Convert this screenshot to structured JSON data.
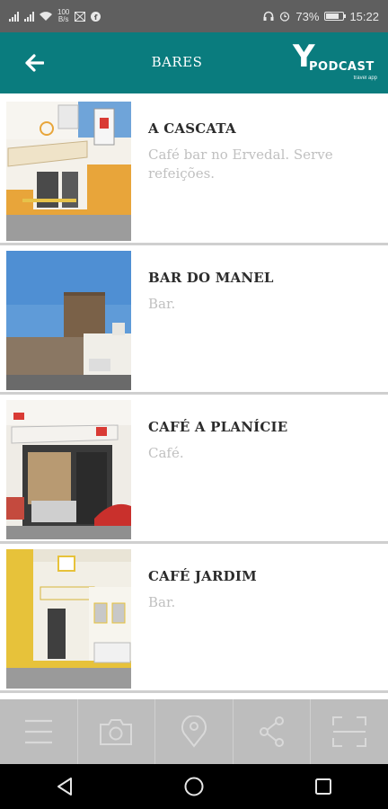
{
  "status_bar": {
    "network_speed": "100",
    "network_unit": "B/s",
    "battery": "73%",
    "battery_level": 0.73,
    "time": "15:22"
  },
  "app_bar": {
    "title": "BARES",
    "logo_mark": "Y",
    "logo_word": "PODCAST",
    "logo_sub": "travel app",
    "color": "#0a7c7e"
  },
  "items": [
    {
      "title": "A CASCATA",
      "description": "Café bar no Ervedal. Serve refeições."
    },
    {
      "title": "BAR DO MANEL",
      "description": "Bar."
    },
    {
      "title": "CAFÉ A PLANÍCIE",
      "description": "Café."
    },
    {
      "title": "CAFÉ JARDIM",
      "description": "Bar."
    }
  ],
  "bottom_toolbar": [
    "menu-icon",
    "camera-icon",
    "location-pin-icon",
    "share-icon",
    "scan-icon"
  ],
  "system_nav": [
    "back-icon",
    "home-icon",
    "recents-icon"
  ]
}
